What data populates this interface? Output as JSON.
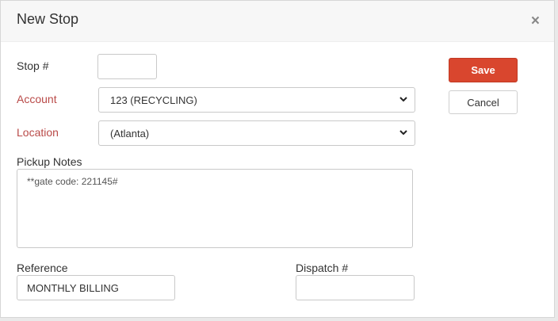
{
  "modal": {
    "title": "New Stop",
    "close_label": "×"
  },
  "form": {
    "stop_number": {
      "label": "Stop #",
      "value": ""
    },
    "account": {
      "label": "Account",
      "selected": "123 (RECYCLING)"
    },
    "location": {
      "label": "Location",
      "selected": "(Atlanta)"
    },
    "pickup_notes": {
      "label": "Pickup Notes",
      "value": "**gate code: 221145#"
    },
    "reference": {
      "label": "Reference",
      "value": "MONTHLY BILLING"
    },
    "dispatch_number": {
      "label": "Dispatch #",
      "value": ""
    }
  },
  "actions": {
    "save_label": "Save",
    "cancel_label": "Cancel"
  },
  "icons": {
    "close": "close-icon",
    "dropdown": "chevron-down-icon"
  },
  "colors": {
    "required_label": "#b94a48",
    "save_button": "#d9462e"
  }
}
